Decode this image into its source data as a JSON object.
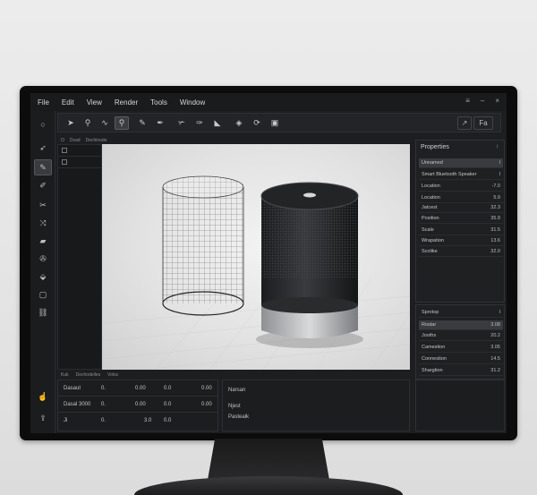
{
  "menu": [
    "File",
    "Edit",
    "View",
    "Render",
    "Tools",
    "Window"
  ],
  "window_controls": [
    "≡",
    "–",
    "×"
  ],
  "left_tools": [
    "pointer-icon",
    "pen-icon",
    "eraser-icon",
    "knife-icon",
    "bridge-icon",
    "brush-icon",
    "mask-icon",
    "fill-icon",
    "rect-select-icon",
    "link-icon",
    "hand-icon",
    "export-icon"
  ],
  "toolbar_tools": [
    "select-arrow-icon",
    "zoom-icon",
    "curve-icon",
    "frame-zoom-icon",
    "pen-tool-icon",
    "dropper-icon",
    "knife-tool-icon",
    "pen-nib-icon",
    "fill-tool-icon",
    "node-icon",
    "lasso-icon",
    "crop-icon"
  ],
  "toolbar_right": [
    "↗",
    "Fa"
  ],
  "tabs_top": [
    "O",
    "Dzad",
    "Dechinode"
  ],
  "viewport_colors": {
    "accent": "#3a3b3f",
    "speaker_body": "#2a2b2d",
    "speaker_base": "#9a9c9f"
  },
  "properties": {
    "title": "Properties",
    "rows": [
      {
        "label": "Unnamed",
        "value": "I"
      },
      {
        "label": "Smart Bluetooth Speaker",
        "value": "I"
      },
      {
        "label": "Location",
        "value": "-7.0"
      },
      {
        "label": "Location",
        "value": "5.9"
      },
      {
        "label": "Jatcest",
        "value": "32.3"
      },
      {
        "label": "Position",
        "value": "35.9"
      },
      {
        "label": "Scale",
        "value": "31.5"
      },
      {
        "label": "Wrapation",
        "value": "13.6"
      },
      {
        "label": "Scolike",
        "value": "32.0"
      }
    ],
    "rows2": [
      {
        "label": "Sprotop",
        "value": "I"
      },
      {
        "label": "Rostar",
        "value": "3.08"
      },
      {
        "label": "Jooths",
        "value": "20.2"
      },
      {
        "label": "Camestion",
        "value": "3.05"
      },
      {
        "label": "Connestion",
        "value": "14.5"
      },
      {
        "label": "Shargtion",
        "value": "31.2"
      }
    ]
  },
  "bottom_tabs": [
    "Kuk",
    "Dechodelles",
    "Voloc"
  ],
  "bottom_rows": [
    {
      "label": "Dasaut",
      "x": "0.",
      "v1": "0.00",
      "v2": "0.0",
      "v3": "0.00"
    },
    {
      "label": "Dasal 3000",
      "x": "0.",
      "v1": "0.00",
      "v2": "0.0",
      "v3": "0.00"
    },
    {
      "label": "Ji",
      "x": "0.",
      "v1": "3.0",
      "v2": "0.0",
      "v3": ""
    }
  ],
  "bottom_mid": [
    "Narsan",
    "Njest",
    "Pastealk"
  ]
}
